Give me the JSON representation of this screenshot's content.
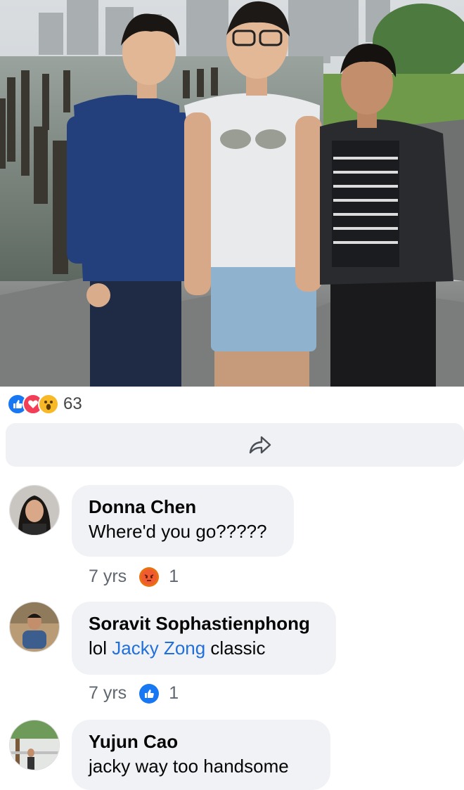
{
  "post": {
    "reaction_icons": [
      "like-icon",
      "love-icon",
      "wow-icon"
    ],
    "reaction_count": "63",
    "share_icon": "share-icon"
  },
  "comments": [
    {
      "author": "Donna Chen",
      "text": "Where'd you go?????",
      "time": "7 yrs",
      "reaction_icon": "angry-icon",
      "reaction_count": "1"
    },
    {
      "author": "Soravit Sophastienphong",
      "text_prefix": "lol ",
      "mention": "Jacky Zong",
      "text_suffix": " classic",
      "time": "7 yrs",
      "reaction_icon": "like-icon",
      "reaction_count": "1"
    },
    {
      "author": "Yujun Cao",
      "text": "jacky way too handsome"
    }
  ],
  "colors": {
    "like": "#1877f2",
    "love": "#f33e58",
    "wow": "#f7b928",
    "mention_link": "#216fdb",
    "bubble_bg": "#f0f2f5"
  }
}
